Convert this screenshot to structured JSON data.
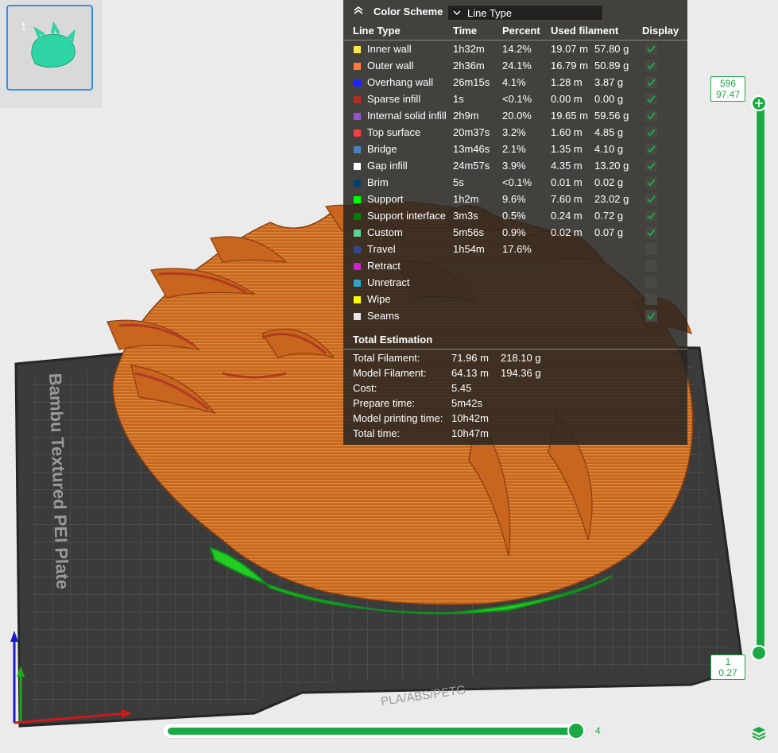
{
  "thumbnail": {
    "index": "1"
  },
  "plate": {
    "label": "Bambu Textured PEI Plate",
    "material_label": "PLA/ABS/PETG"
  },
  "legend": {
    "scheme_label": "Color Scheme",
    "scheme_value": "Line Type",
    "columns": {
      "line_type": "Line Type",
      "time": "Time",
      "percent": "Percent",
      "used_filament": "Used filament",
      "display": "Display"
    },
    "rows": [
      {
        "label": "Inner wall",
        "time": "1h32m",
        "percent": "14.2%",
        "meters": "19.07 m",
        "grams": "57.80 g",
        "color": "#ffe54d",
        "display": true
      },
      {
        "label": "Outer wall",
        "time": "2h36m",
        "percent": "24.1%",
        "meters": "16.79 m",
        "grams": "50.89 g",
        "color": "#ff7d38",
        "display": true
      },
      {
        "label": "Overhang wall",
        "time": "26m15s",
        "percent": "4.1%",
        "meters": "1.28 m",
        "grams": "3.87 g",
        "color": "#1f1fff",
        "display": true
      },
      {
        "label": "Sparse infill",
        "time": "1s",
        "percent": "<0.1%",
        "meters": "0.00 m",
        "grams": "0.00 g",
        "color": "#b03029",
        "display": true
      },
      {
        "label": "Internal solid infill",
        "time": "2h9m",
        "percent": "20.0%",
        "meters": "19.65 m",
        "grams": "59.56 g",
        "color": "#9654cc",
        "display": true
      },
      {
        "label": "Top surface",
        "time": "20m37s",
        "percent": "3.2%",
        "meters": "1.60 m",
        "grams": "4.85 g",
        "color": "#f04040",
        "display": true
      },
      {
        "label": "Bridge",
        "time": "13m46s",
        "percent": "2.1%",
        "meters": "1.35 m",
        "grams": "4.10 g",
        "color": "#4d80ba",
        "display": true
      },
      {
        "label": "Gap infill",
        "time": "24m57s",
        "percent": "3.9%",
        "meters": "4.35 m",
        "grams": "13.20 g",
        "color": "#ffffff",
        "display": true
      },
      {
        "label": "Brim",
        "time": "5s",
        "percent": "<0.1%",
        "meters": "0.01 m",
        "grams": "0.02 g",
        "color": "#00406e",
        "display": true
      },
      {
        "label": "Support",
        "time": "1h2m",
        "percent": "9.6%",
        "meters": "7.60 m",
        "grams": "23.02 g",
        "color": "#00ff00",
        "display": true
      },
      {
        "label": "Support interface",
        "time": "3m3s",
        "percent": "0.5%",
        "meters": "0.24 m",
        "grams": "0.72 g",
        "color": "#008000",
        "display": true
      },
      {
        "label": "Custom",
        "time": "5m56s",
        "percent": "0.9%",
        "meters": "0.02 m",
        "grams": "0.07 g",
        "color": "#5ed194",
        "display": true
      },
      {
        "label": "Travel",
        "time": "1h54m",
        "percent": "17.6%",
        "meters": "",
        "grams": "",
        "color": "#38488c",
        "display": false
      },
      {
        "label": "Retract",
        "time": "",
        "percent": "",
        "meters": "",
        "grams": "",
        "color": "#cc22cc",
        "display": false
      },
      {
        "label": "Unretract",
        "time": "",
        "percent": "",
        "meters": "",
        "grams": "",
        "color": "#33a3c8",
        "display": false
      },
      {
        "label": "Wipe",
        "time": "",
        "percent": "",
        "meters": "",
        "grams": "",
        "color": "#ffff00",
        "display": false
      },
      {
        "label": "Seams",
        "time": "",
        "percent": "",
        "meters": "",
        "grams": "",
        "color": "#e6e6e6",
        "display": true
      }
    ],
    "total": {
      "title": "Total Estimation",
      "rows": [
        {
          "label": "Total Filament:",
          "value": "71.96 m",
          "value2": "218.10 g"
        },
        {
          "label": "Model Filament:",
          "value": "64.13 m",
          "value2": "194.36 g"
        },
        {
          "label": "Cost:",
          "value": "5.45",
          "value2": ""
        },
        {
          "label": "Prepare time:",
          "value": "5m42s",
          "value2": ""
        },
        {
          "label": "Model printing time:",
          "value": "10h42m",
          "value2": ""
        },
        {
          "label": "Total time:",
          "value": "10h47m",
          "value2": ""
        }
      ]
    }
  },
  "layer_slider": {
    "top_layer": "596",
    "top_height": "97.47",
    "bottom_layer": "1",
    "bottom_height": "0.27"
  },
  "move_slider": {
    "value": "4"
  },
  "colors": {
    "accent": "#1aaa44",
    "model": "#c8651e",
    "support": "#00ff00",
    "bed": "#3a3a3a"
  }
}
